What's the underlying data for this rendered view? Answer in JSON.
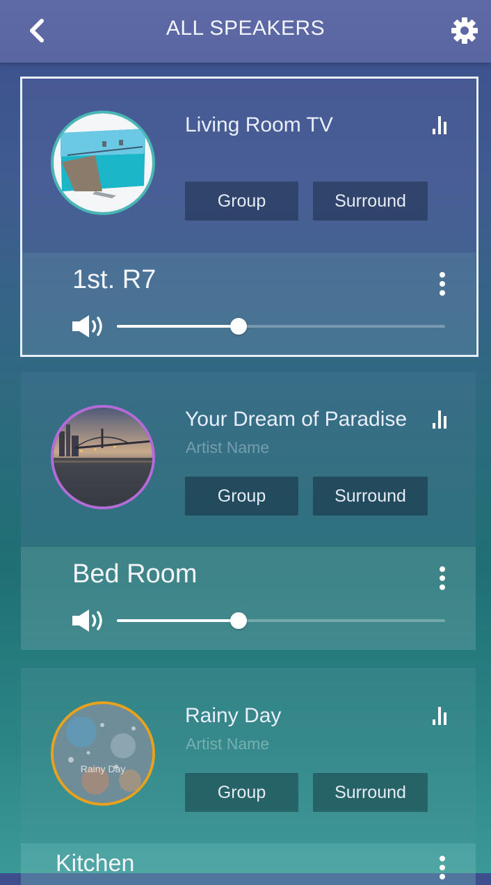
{
  "header": {
    "title": "ALL SPEAKERS",
    "back_icon": "chevron-left-icon",
    "settings_icon": "gear-icon"
  },
  "speakers": [
    {
      "track_title": "Living Room TV",
      "artist": "",
      "group_label": "Group",
      "surround_label": "Surround",
      "speaker_name": "1st. R7",
      "volume": 0.37,
      "album_icon": "ocean-villa-tv-artwork",
      "selected": true
    },
    {
      "track_title": "Your Dream of Paradise",
      "artist": "Artist Name",
      "group_label": "Group",
      "surround_label": "Surround",
      "speaker_name": "Bed Room",
      "volume": 0.37,
      "album_icon": "city-bridge-artwork",
      "selected": false
    },
    {
      "track_title": "Rainy Day",
      "artist": "Artist Name",
      "group_label": "Group",
      "surround_label": "Surround",
      "speaker_name": "Kitchen",
      "album_icon": "rainy-window-artwork",
      "album_text": "Rainy Day",
      "selected": false
    }
  ],
  "colors": {
    "header_bg": "#5e6aa6",
    "accent": "#ffffff",
    "pill_bg": "#2a3a5c"
  }
}
